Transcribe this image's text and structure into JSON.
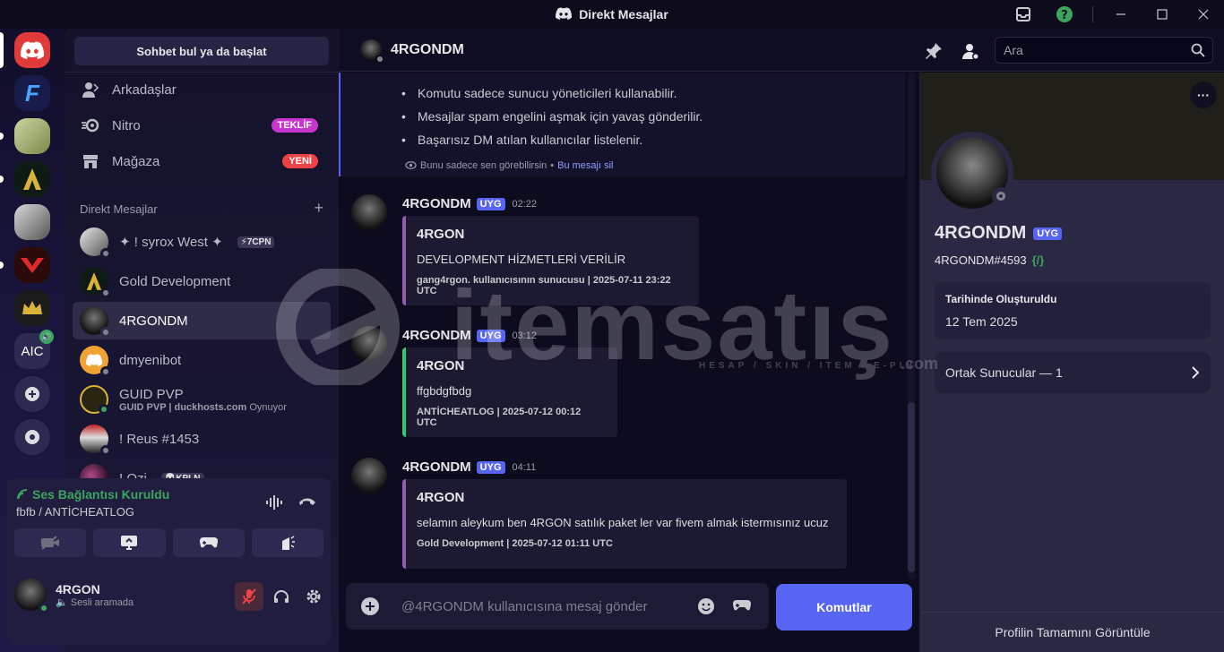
{
  "window": {
    "title": "Direkt Mesajlar"
  },
  "servers": [
    {
      "name": "Discord Home",
      "label": ""
    },
    {
      "name": "Server F",
      "label": ""
    },
    {
      "name": "Server Money",
      "label": ""
    },
    {
      "name": "Gold Development",
      "label": ""
    },
    {
      "name": "Server Hand",
      "label": ""
    },
    {
      "name": "Server V",
      "label": ""
    },
    {
      "name": "Server Crown",
      "label": ""
    },
    {
      "name": "AIC",
      "label": "AIC"
    }
  ],
  "sidebar": {
    "search_label": "Sohbet bul ya da başlat",
    "nav": [
      {
        "label": "Arkadaşlar",
        "badge": ""
      },
      {
        "label": "Nitro",
        "badge": "TEKLİF"
      },
      {
        "label": "Mağaza",
        "badge": "YENİ"
      }
    ],
    "dm_header": "Direkt Mesajlar",
    "dm_add": "+",
    "dms": [
      {
        "name": "✦ ! syrox West ✦",
        "tag": "⚡7CPN",
        "sub": ""
      },
      {
        "name": "Gold Development",
        "tag": "",
        "sub": ""
      },
      {
        "name": "4RGONDM",
        "tag": "",
        "sub": ""
      },
      {
        "name": "dmyenibot",
        "tag": "",
        "sub": ""
      },
      {
        "name": "GUID PVP",
        "tag": "",
        "sub_bold": "GUID PVP | duckhosts.com",
        "sub": "Oynuyor"
      },
      {
        "name": "! Reus #1453",
        "tag": "",
        "sub": ""
      },
      {
        "name": "! Ozi",
        "tag": "💀KPLN",
        "sub": ""
      }
    ]
  },
  "voice": {
    "title": "Ses Bağlantısı Kuruldu",
    "sub": "fbfb / ANTİCHEATLOG"
  },
  "user": {
    "name": "4RGON",
    "status": "Sesli aramada"
  },
  "chat": {
    "channel": "4RGONDM",
    "search_placeholder": "Ara",
    "ephemeral": {
      "items": [
        "Komutu sadece sunucu yöneticileri kullanabilir.",
        "Mesajlar spam engelini aşmak için yavaş gönderilir.",
        "Başarısız DM atılan kullanıcılar listelenir."
      ],
      "note": "Bunu sadece sen görebilirsin",
      "note_sep": "•",
      "note_link": "Bu mesajı sil"
    },
    "messages": [
      {
        "author": "4RGONDM",
        "badge": "UYG",
        "time": "02:22",
        "embed_title": "4RGON",
        "embed_desc": "DEVELOPMENT HİZMETLERİ VERİLİR",
        "embed_footer": "gang4rgon. kullanıcısının sunucusu | 2025-07-11 23:22 UTC",
        "color": "#9b59b6"
      },
      {
        "author": "4RGONDM",
        "badge": "UYG",
        "time": "03:12",
        "embed_title": "4RGON",
        "embed_desc": "ffgbdgfbdg",
        "embed_footer": "ANTİCHEATLOG | 2025-07-12 00:12 UTC",
        "color": "#2ecc71"
      },
      {
        "author": "4RGONDM",
        "badge": "UYG",
        "time": "04:11",
        "embed_title": "4RGON",
        "embed_desc": "selamın aleykum ben 4RGON satılık paket ler var fivem almak istermısınız ucuz",
        "embed_footer": "Gold Development | 2025-07-12 01:11 UTC",
        "color": "#9b59b6"
      }
    ],
    "input_placeholder": "@4RGONDM kullanıcısına mesaj gönder",
    "commands_label": "Komutlar"
  },
  "profile": {
    "display_name": "4RGONDM",
    "badge": "UYG",
    "tag": "4RGONDM#4593",
    "tag_code": "{/}",
    "created_label": "Tarihinde Oluşturuldu",
    "created_value": "12 Tem 2025",
    "mutual_label": "Ortak Sunucular — 1",
    "footer": "Profilin Tamamını Görüntüle",
    "more": "···"
  },
  "watermark": {
    "brand": "itemsatış",
    "tagline": "HESAP / SKIN / ITEM / E-PIN",
    "suffix": ".com"
  },
  "colors": {
    "accent": "#5865f2",
    "online": "#3ba55d",
    "dnd": "#ed4245",
    "nitro_badge": "#c735cf",
    "new_badge": "#ed4245"
  }
}
